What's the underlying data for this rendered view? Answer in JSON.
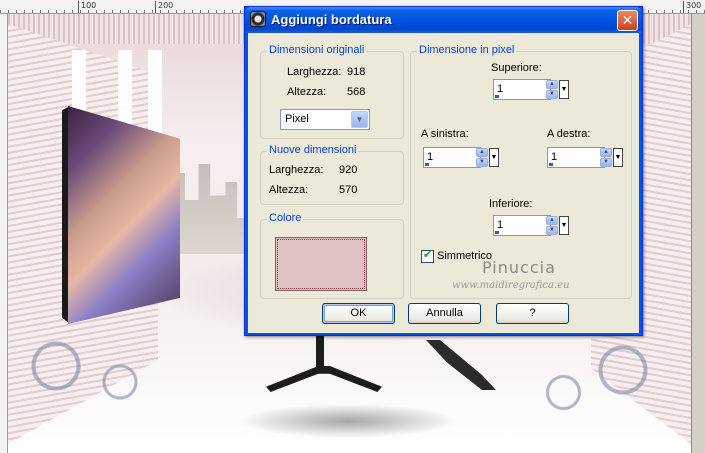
{
  "ruler": {
    "marks": [
      "100",
      "200",
      "300"
    ]
  },
  "dialog": {
    "title": "Aggiungi bordatura",
    "close_label": "✕",
    "original": {
      "title": "Dimensioni originali",
      "width_label": "Larghezza:",
      "width_value": "918",
      "height_label": "Altezza:",
      "height_value": "568",
      "unit": "Pixel"
    },
    "new": {
      "title": "Nuove dimensioni",
      "width_label": "Larghezza:",
      "width_value": "920",
      "height_label": "Altezza:",
      "height_value": "570"
    },
    "color": {
      "title": "Colore",
      "value": "#dfc2c2"
    },
    "pixel": {
      "title": "Dimensione in pixel",
      "top_label": "Superiore:",
      "top_value": "1",
      "left_label": "A sinistra:",
      "left_value": "1",
      "right_label": "A destra:",
      "right_value": "1",
      "bottom_label": "Inferiore:",
      "bottom_value": "1",
      "symmetric_label": "Simmetrico",
      "symmetric_checked": true
    },
    "buttons": {
      "ok": "OK",
      "cancel": "Annulla",
      "help": "?"
    }
  },
  "watermark": {
    "name": "Pinuccia",
    "url": "www.maidiregrafica.eu"
  },
  "colors": {
    "title_bar": "#0054e3",
    "dialog_bg": "#ece9d8",
    "group_title": "#0046d5"
  }
}
